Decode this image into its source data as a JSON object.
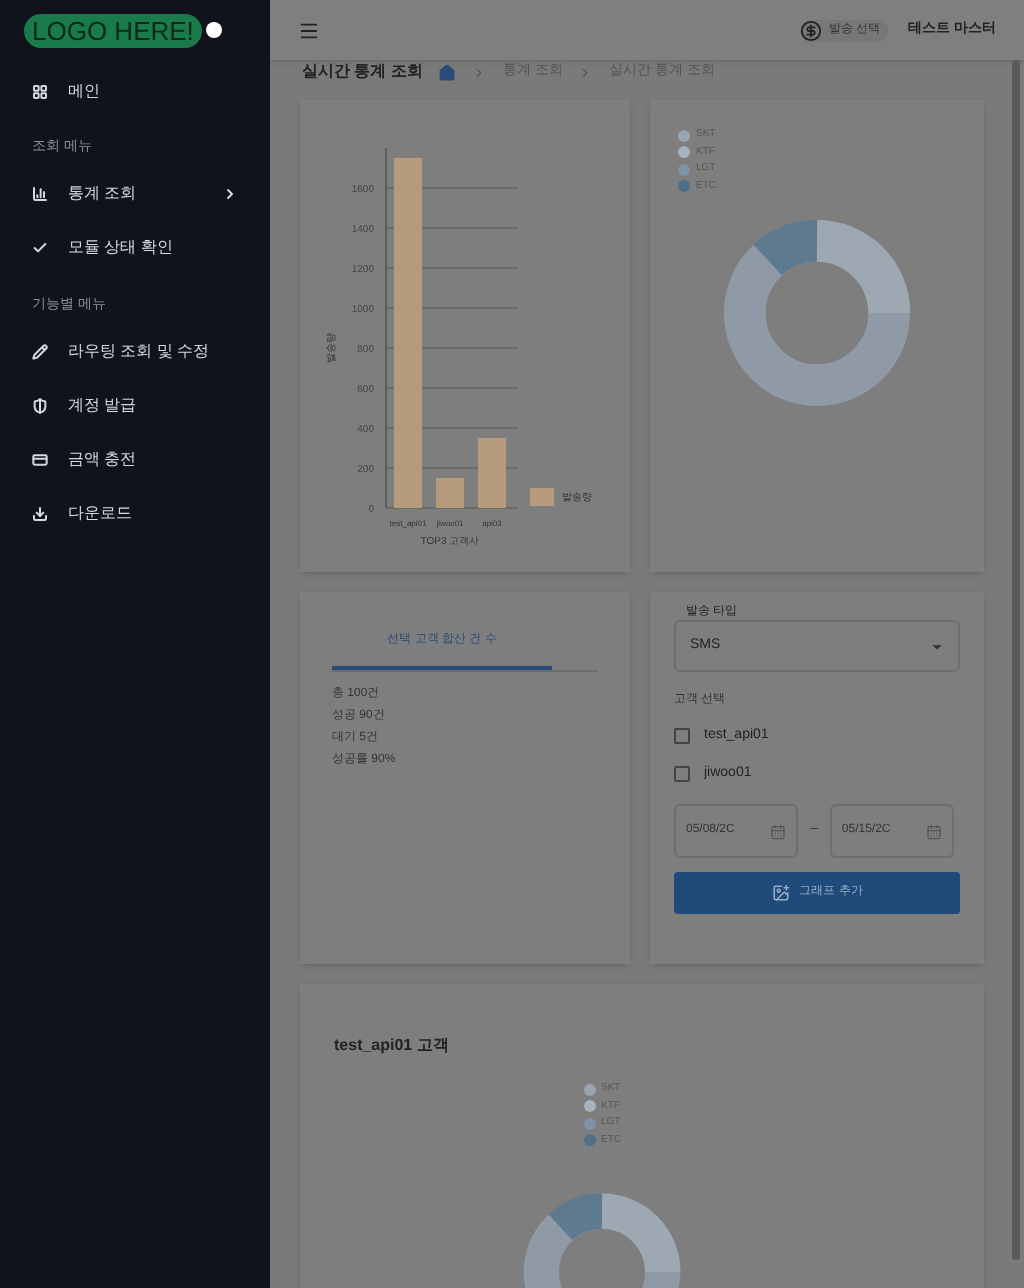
{
  "sidebar": {
    "logo": "LOGO HERE!",
    "items": [
      {
        "kind": "item",
        "label": "메인",
        "chevron": false
      },
      {
        "kind": "section",
        "label": "조회 메뉴"
      },
      {
        "kind": "item",
        "label": "통계 조회",
        "chevron": true
      },
      {
        "kind": "item",
        "label": "모듈 상태 확인",
        "chevron": false
      },
      {
        "kind": "section",
        "label": "기능별 메뉴"
      },
      {
        "kind": "item",
        "label": "라우팅 조회 및 수정",
        "chevron": false
      },
      {
        "kind": "item",
        "label": "계정 발급",
        "chevron": false
      },
      {
        "kind": "item",
        "label": "금액 충전",
        "chevron": false
      },
      {
        "kind": "item",
        "label": "다운로드",
        "chevron": false
      }
    ]
  },
  "header": {
    "balance_label": "발송 선택",
    "user": "테스트 마스터"
  },
  "breadcrumb": {
    "title": "실시간 통계 조회",
    "path": [
      "통계 조회",
      "실시간 통계 조회"
    ]
  },
  "bar_chart": {
    "chart_data": {
      "type": "bar",
      "xlabel": "TOP3 고객사",
      "ylabel": "발송량",
      "categories": [
        "test_api01",
        "jiwoo01",
        "api03"
      ],
      "series": [
        {
          "name": "발송량",
          "color": "#b59b7c",
          "values": [
            1750,
            150,
            350
          ]
        }
      ],
      "ylim": [
        0,
        1800
      ],
      "grid": true,
      "yticks": [
        0,
        200,
        400,
        600,
        800,
        1000,
        1200,
        1400,
        1600
      ]
    }
  },
  "donut_legend": [
    "SKT",
    "KTF",
    "LGT",
    "ETC"
  ],
  "summary": {
    "tab": "선택 고객 합산 건 수",
    "lines": [
      "총 100건",
      "성공 90건",
      "대기 5건",
      "성공률 90%"
    ]
  },
  "form": {
    "type_label": "발송 타입",
    "type_value": "SMS",
    "customer_label": "고객 선택",
    "customers": [
      {
        "label": "test_api01",
        "checked": false
      },
      {
        "label": "jiwoo01",
        "checked": false
      }
    ],
    "start_date": "05/08/2C",
    "end_date": "05/15/2C",
    "separator": "–",
    "button": "그래프 추가"
  },
  "customer_card": {
    "title": "test_api01 고객",
    "legend": [
      "SKT",
      "KTF",
      "LGT",
      "ETC"
    ]
  }
}
